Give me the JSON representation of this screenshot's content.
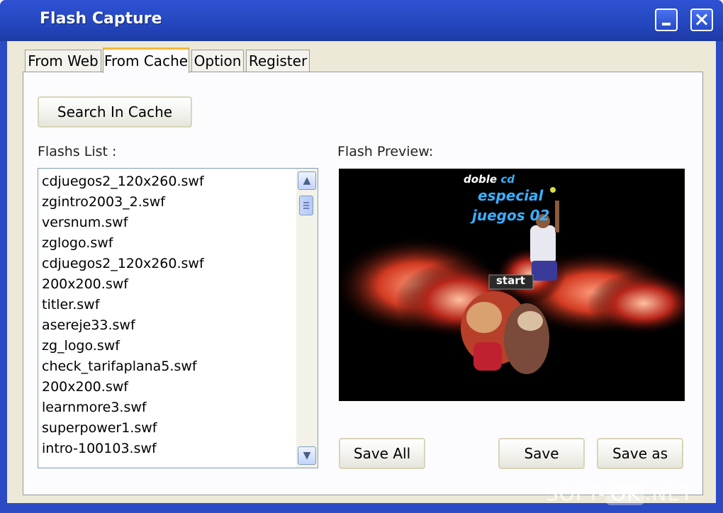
{
  "window": {
    "title": "Flash Capture"
  },
  "tabs": [
    {
      "label": "From Web",
      "active": false
    },
    {
      "label": "From Cache",
      "active": true
    },
    {
      "label": "Option",
      "active": false
    },
    {
      "label": "Register",
      "active": false
    }
  ],
  "buttons": {
    "search_cache": "Search In Cache",
    "save_all": "Save All",
    "save": "Save",
    "save_as": "Save as"
  },
  "labels": {
    "flash_list": "Flashs List :",
    "flash_preview": "Flash Preview:"
  },
  "flash_list": [
    "cdjuegos2_120x260.swf",
    "zgintro2003_2.swf",
    "versnum.swf",
    "zglogo.swf",
    "cdjuegos2_120x260.swf",
    "200x200.swf",
    "titler.swf",
    "asereje33.swf",
    "zg_logo.swf",
    "check_tarifaplana5.swf",
    "200x200.swf",
    "learnmore3.swf",
    "superpower1.swf",
    "intro-100103.swf"
  ],
  "preview": {
    "line1a": "doble",
    "line1b": "cd",
    "line2": "especial",
    "line3": "juegos 02",
    "start": "start"
  },
  "watermark": {
    "left": "SOFT-",
    "ok": "OK",
    "right": ".NET"
  },
  "colors": {
    "titlebar": "#2446bd",
    "tab_highlight": "#f4b93a",
    "panel": "#fcfcfe"
  }
}
